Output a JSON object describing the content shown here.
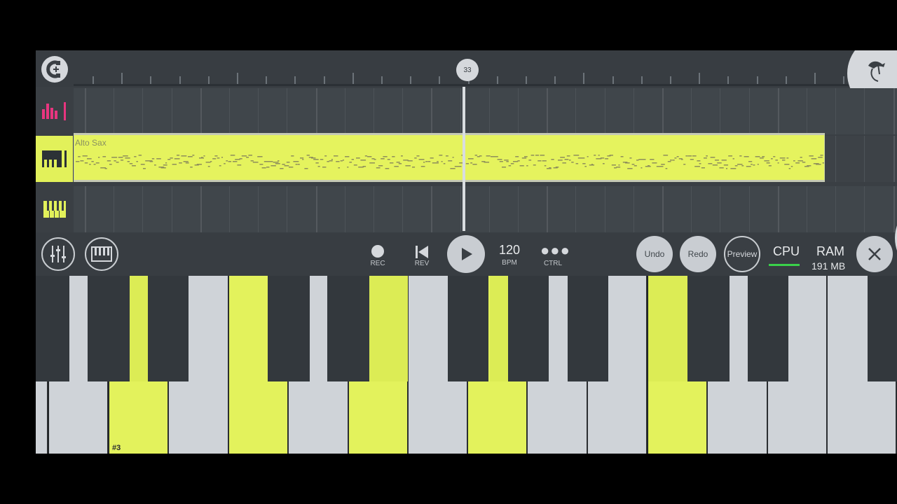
{
  "timeline": {
    "position_badge": "33"
  },
  "tracks": [
    {
      "id": "mixer-track",
      "icon": "mixer-icon",
      "accent": "#e8357f"
    },
    {
      "id": "alto-sax-track",
      "icon": "piano-roll-icon",
      "pattern_name": "Alto Sax",
      "selected": true,
      "accent": "#e5f35e"
    },
    {
      "id": "keyboard-track",
      "icon": "keyboard-icon",
      "accent": "#e5f35e"
    }
  ],
  "toolbar": {
    "rec_label": "REC",
    "rev_label": "REV",
    "bpm_value": "120",
    "bpm_label": "BPM",
    "ctrl_label": "CTRL",
    "undo_label": "Undo",
    "redo_label": "Redo",
    "preview_label": "Preview",
    "cpu_label": "CPU",
    "ram_label": "RAM",
    "ram_value": "191 MB"
  },
  "keyboard": {
    "octave_label": "#3",
    "lit_color": "#e3f25c"
  },
  "colors": {
    "background": "#3a3f44",
    "highlight": "#e5f35e",
    "mixer_pink": "#e8357f",
    "cpu_green": "#3ad14a"
  }
}
